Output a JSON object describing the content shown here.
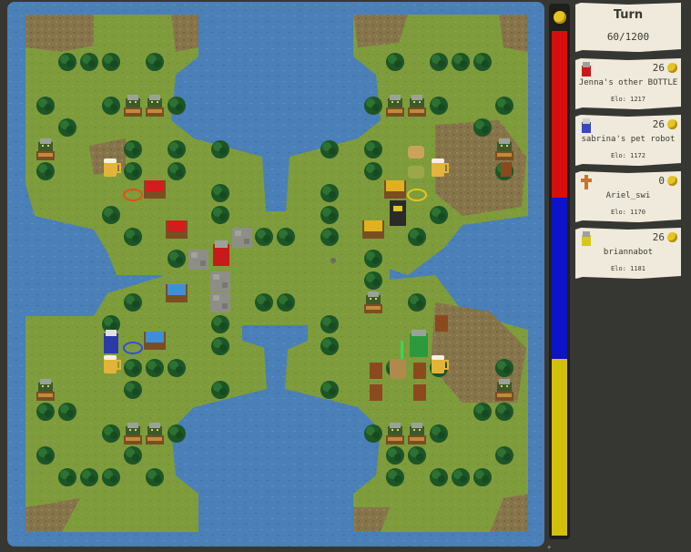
{
  "turn": {
    "title": "Turn",
    "counter": "60/1200"
  },
  "players": [
    {
      "name": "Jenna's other BOTTLE",
      "elo": "Elo: 1217",
      "gold": "26",
      "color": "#c81a1a",
      "avatar": "red-soldier-icon"
    },
    {
      "name": "sabrina's pet robot",
      "elo": "Elo: 1172",
      "gold": "26",
      "color": "#3a48b8",
      "avatar": "blue-soldier-icon"
    },
    {
      "name": "Ariel_swi",
      "elo": "Elo: 1170",
      "gold": "0",
      "color": "#c8742a",
      "avatar": "tombstone-cross-icon"
    },
    {
      "name": "briannabot",
      "elo": "Elo: 1181",
      "gold": "26",
      "color": "#d6c81a",
      "avatar": "yellow-soldier-icon"
    }
  ],
  "score_bar": {
    "colors": [
      "#d80e0e",
      "#0e12c8",
      "#d0c20c"
    ],
    "fractions": [
      0.33,
      0.32,
      0.35
    ]
  },
  "footer": "+",
  "map": {
    "water": "#4a7fb8",
    "grass": "#7b9a3a",
    "dirt": "#8c7a4c",
    "tree": "#1f5a26"
  }
}
